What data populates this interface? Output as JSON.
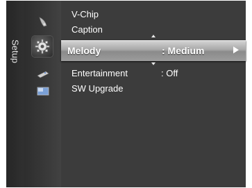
{
  "sidebar": {
    "label": "Setup",
    "icons": [
      "satellite-dish-icon",
      "gear-icon",
      "remote-control-icon",
      "display-icon"
    ]
  },
  "menu": {
    "items": [
      {
        "label": "V-Chip",
        "value": ""
      },
      {
        "label": "Caption",
        "value": ""
      },
      {
        "label": "Melody",
        "value": ": Medium",
        "selected": true
      },
      {
        "label": "Entertainment",
        "value": ": Off"
      },
      {
        "label": "SW Upgrade",
        "value": ""
      }
    ]
  },
  "colors": {
    "background": "#3c3c3c",
    "highlight": "#a8a8a8",
    "text": "#ffffff"
  }
}
